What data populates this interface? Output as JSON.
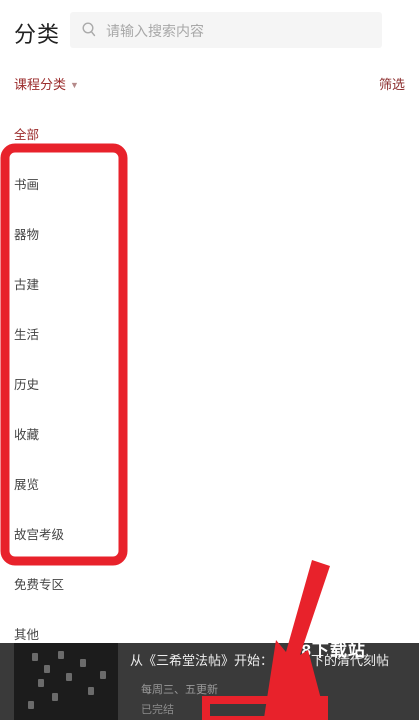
{
  "header": {
    "title": "分类",
    "search_placeholder": "请输入搜索内容"
  },
  "filter_bar": {
    "course_category_label": "课程分类",
    "filter_label": "筛选"
  },
  "categories": [
    {
      "label": "全部",
      "active": true
    },
    {
      "label": "书画",
      "active": false
    },
    {
      "label": "器物",
      "active": false
    },
    {
      "label": "古建",
      "active": false
    },
    {
      "label": "生活",
      "active": false
    },
    {
      "label": "历史",
      "active": false
    },
    {
      "label": "收藏",
      "active": false
    },
    {
      "label": "展览",
      "active": false
    },
    {
      "label": "故宫考级",
      "active": false
    },
    {
      "label": "免费专区",
      "active": false
    },
    {
      "label": "其他",
      "active": false
    }
  ],
  "course_card": {
    "title": "从《三希堂法帖》开始：",
    "title_rest": "下的清代刻帖",
    "subtitle": "每周三、五更新",
    "subtitle2": "已完结"
  },
  "watermark": "78下载站",
  "colors": {
    "accent": "#9b2c2c",
    "annotation_red": "#e8222b"
  }
}
